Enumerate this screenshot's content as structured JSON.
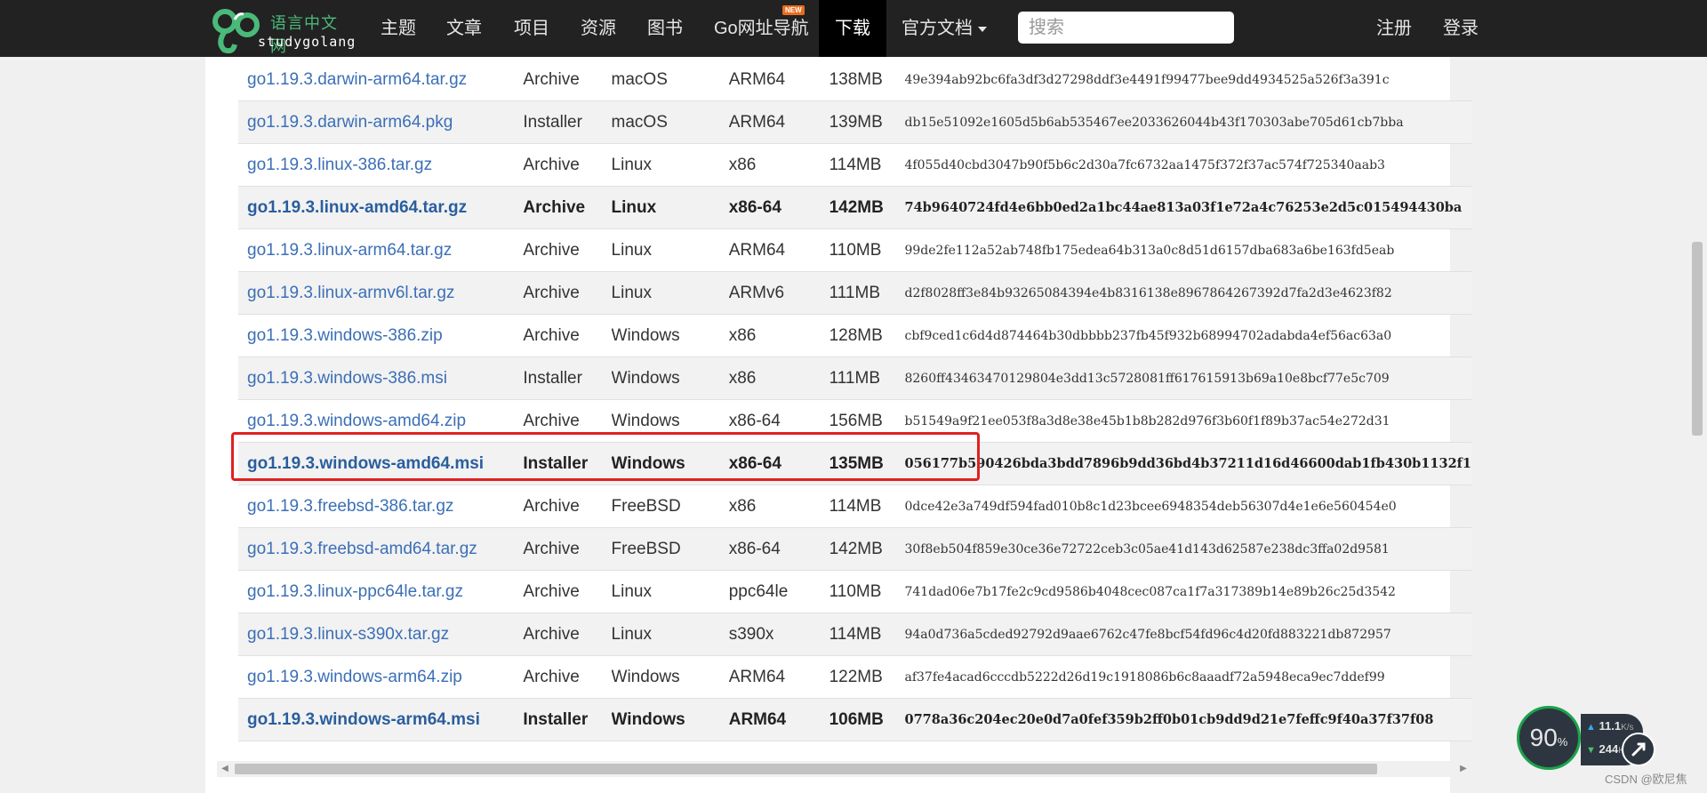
{
  "navbar": {
    "logo_cn": "语言中文网",
    "logo_en": "studygolang",
    "items": [
      "主题",
      "文章",
      "项目",
      "资源",
      "图书",
      "Go网址导航",
      "下载",
      "官方文档"
    ],
    "new_badge": "NEW",
    "search_placeholder": "搜索",
    "register": "注册",
    "login": "登录"
  },
  "downloads": {
    "rows": [
      {
        "file": "go1.19.3.darwin-arm64.tar.gz",
        "kind": "Archive",
        "os": "macOS",
        "arch": "ARM64",
        "size": "138MB",
        "sha256": "49e394ab92bc6fa3df3d27298ddf3e4491f99477bee9dd4934525a526f3a391c"
      },
      {
        "file": "go1.19.3.darwin-arm64.pkg",
        "kind": "Installer",
        "os": "macOS",
        "arch": "ARM64",
        "size": "139MB",
        "sha256": "db15e51092e1605d5b6ab535467ee2033626044b43f170303abe705d61cb7bba"
      },
      {
        "file": "go1.19.3.linux-386.tar.gz",
        "kind": "Archive",
        "os": "Linux",
        "arch": "x86",
        "size": "114MB",
        "sha256": "4f055d40cbd3047b90f5b6c2d30a7fc6732aa1475f372f37ac574f725340aab3"
      },
      {
        "file": "go1.19.3.linux-amd64.tar.gz",
        "kind": "Archive",
        "os": "Linux",
        "arch": "x86-64",
        "size": "142MB",
        "sha256": "74b9640724fd4e6bb0ed2a1bc44ae813a03f1e72a4c76253e2d5c015494430ba"
      },
      {
        "file": "go1.19.3.linux-arm64.tar.gz",
        "kind": "Archive",
        "os": "Linux",
        "arch": "ARM64",
        "size": "110MB",
        "sha256": "99de2fe112a52ab748fb175edea64b313a0c8d51d6157dba683a6be163fd5eab"
      },
      {
        "file": "go1.19.3.linux-armv6l.tar.gz",
        "kind": "Archive",
        "os": "Linux",
        "arch": "ARMv6",
        "size": "111MB",
        "sha256": "d2f8028ff3e84b93265084394e4b8316138e8967864267392d7fa2d3e4623f82"
      },
      {
        "file": "go1.19.3.windows-386.zip",
        "kind": "Archive",
        "os": "Windows",
        "arch": "x86",
        "size": "128MB",
        "sha256": "cbf9ced1c6d4d874464b30dbbbb237fb45f932b68994702adabda4ef56ac63a0"
      },
      {
        "file": "go1.19.3.windows-386.msi",
        "kind": "Installer",
        "os": "Windows",
        "arch": "x86",
        "size": "111MB",
        "sha256": "8260ff43463470129804e3dd13c5728081ff617615913b69a10e8bcf77e5c709"
      },
      {
        "file": "go1.19.3.windows-amd64.zip",
        "kind": "Archive",
        "os": "Windows",
        "arch": "x86-64",
        "size": "156MB",
        "sha256": "b51549a9f21ee053f8a3d8e38e45b1b8b282d976f3b60f1f89b37ac54e272d31"
      },
      {
        "file": "go1.19.3.windows-amd64.msi",
        "kind": "Installer",
        "os": "Windows",
        "arch": "x86-64",
        "size": "135MB",
        "sha256": "056177b590426bda3bdd7896b9dd36bd4b37211d16d46600dab1fb430b1132f1"
      },
      {
        "file": "go1.19.3.freebsd-386.tar.gz",
        "kind": "Archive",
        "os": "FreeBSD",
        "arch": "x86",
        "size": "114MB",
        "sha256": "0dce42e3a749df594fad010b8c1d23bcee6948354deb56307d4e1e6e560454e0"
      },
      {
        "file": "go1.19.3.freebsd-amd64.tar.gz",
        "kind": "Archive",
        "os": "FreeBSD",
        "arch": "x86-64",
        "size": "142MB",
        "sha256": "30f8eb504f859e30ce36e72722ceb3c05ae41d143d62587e238dc3ffa02d9581"
      },
      {
        "file": "go1.19.3.linux-ppc64le.tar.gz",
        "kind": "Archive",
        "os": "Linux",
        "arch": "ppc64le",
        "size": "110MB",
        "sha256": "741dad06e7b17fe2c9cd9586b4048cec087ca1f7a317389b14e89b26c25d3542"
      },
      {
        "file": "go1.19.3.linux-s390x.tar.gz",
        "kind": "Archive",
        "os": "Linux",
        "arch": "s390x",
        "size": "114MB",
        "sha256": "94a0d736a5cded92792d9aae6762c47fe8bcf54fd96c4d20fd883221db872957"
      },
      {
        "file": "go1.19.3.windows-arm64.zip",
        "kind": "Archive",
        "os": "Windows",
        "arch": "ARM64",
        "size": "122MB",
        "sha256": "af37fe4acad6cccdb5222d26d19c1918086b6c8aaadf72a5948eca9ec7ddef99"
      },
      {
        "file": "go1.19.3.windows-arm64.msi",
        "kind": "Installer",
        "os": "Windows",
        "arch": "ARM64",
        "size": "106MB",
        "sha256": "0778a36c204ec20e0d7a0fef359b2ff0b01cb9dd9d21e7feffc9f40a37f37f08"
      }
    ]
  },
  "speed_widget": {
    "percent": "90",
    "percent_sign": "%",
    "upload": "11.1",
    "download": "244",
    "unit": "K/s"
  },
  "watermark": "CSDN @欧尼焦"
}
